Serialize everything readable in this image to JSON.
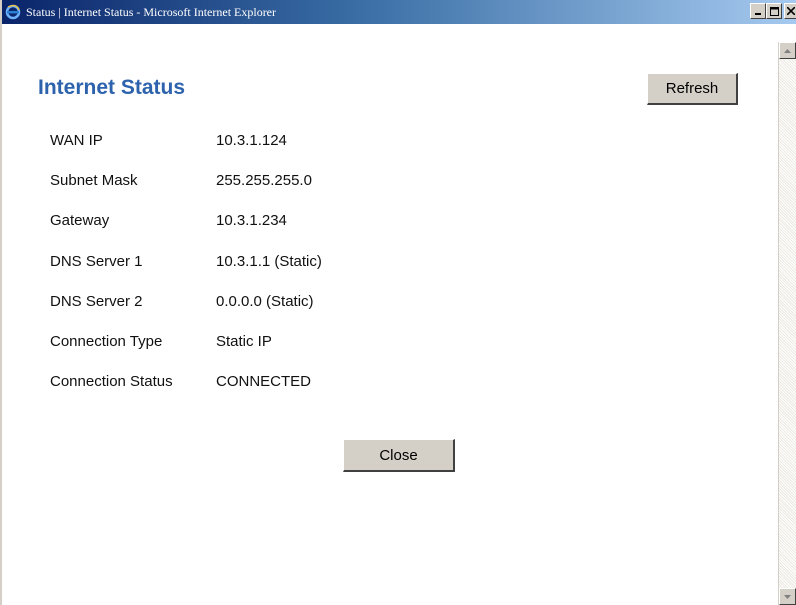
{
  "window": {
    "title": "Status | Internet Status - Microsoft Internet Explorer",
    "icon": "ie-icon",
    "buttons": {
      "minimize": "_",
      "maximize": "□",
      "close": "X"
    }
  },
  "page": {
    "heading": "Internet Status",
    "refresh_label": "Refresh",
    "close_label": "Close"
  },
  "status_rows": [
    {
      "label": "WAN IP",
      "value": "10.3.1.124"
    },
    {
      "label": "Subnet Mask",
      "value": "255.255.255.0"
    },
    {
      "label": "Gateway",
      "value": "10.3.1.234"
    },
    {
      "label": "DNS Server 1",
      "value": "10.3.1.1 (Static)"
    },
    {
      "label": "DNS Server 2",
      "value": "0.0.0.0 (Static)"
    },
    {
      "label": "Connection Type",
      "value": "Static IP"
    },
    {
      "label": "Connection Status",
      "value": "CONNECTED"
    }
  ],
  "colors": {
    "heading": "#2d63ad",
    "titlebar_start": "#0a246a",
    "titlebar_end": "#a6caf0",
    "button_face": "#d4d0c8"
  }
}
